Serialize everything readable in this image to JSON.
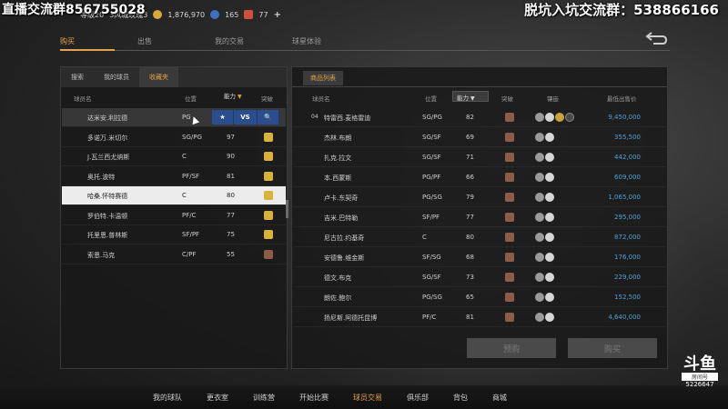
{
  "overlay": {
    "left_text": "直播交流群856755028",
    "right_text": "脱坑入坑交流群：538866166"
  },
  "topbar": {
    "player": "等级20",
    "team": "3风城玫瑰3",
    "coins": "1,876,970",
    "stars": "165",
    "diamonds": "77",
    "plus": "+"
  },
  "main_tabs": [
    {
      "label": "购买",
      "active": true
    },
    {
      "label": "出售",
      "active": false
    },
    {
      "label": "我的交易",
      "active": false
    },
    {
      "label": "球星体验",
      "active": false
    }
  ],
  "left_panel": {
    "subtabs": [
      {
        "label": "搜索",
        "active": false
      },
      {
        "label": "我的球员",
        "active": false
      },
      {
        "label": "收藏夹",
        "active": true
      }
    ],
    "headers": {
      "name": "球员名",
      "position": "位置",
      "ability": "能力",
      "badge": "突破"
    },
    "actions": {
      "star": "★",
      "vs": "VS",
      "search": "🔍"
    },
    "rows": [
      {
        "name": "达米安.利拉德",
        "position": "PG",
        "ability": "",
        "badge": "",
        "state": "hover"
      },
      {
        "name": "多诺万.米切尔",
        "position": "SG/PG",
        "ability": "97",
        "badge": "gold"
      },
      {
        "name": "J.瓦兰西尤纳斯",
        "position": "C",
        "ability": "90",
        "badge": "gold"
      },
      {
        "name": "奥托.波特",
        "position": "PF/SF",
        "ability": "81",
        "badge": "gold"
      },
      {
        "name": "哈桑.怀特赛德",
        "position": "C",
        "ability": "80",
        "badge": "gold",
        "state": "selected"
      },
      {
        "name": "罗伯特.卡温顿",
        "position": "PF/C",
        "ability": "77",
        "badge": "gold"
      },
      {
        "name": "托里恩.普林斯",
        "position": "SF/PF",
        "ability": "75",
        "badge": "gold"
      },
      {
        "name": "索恩.马克",
        "position": "C/PF",
        "ability": "55",
        "badge": "rust"
      }
    ]
  },
  "right_panel": {
    "tab": "商品列表",
    "headers": {
      "name": "球员名",
      "position": "位置",
      "ability": "能力",
      "badge": "突破",
      "slots": "镶嵌",
      "price": "最低出售价"
    },
    "rows": [
      {
        "name": "特雷西.麦格雷迪",
        "position": "SG/PG",
        "ability": "82",
        "price": "9,450,000",
        "prefix": "04"
      },
      {
        "name": "杰林.布朗",
        "position": "SG/SF",
        "ability": "69",
        "price": "355,500"
      },
      {
        "name": "扎克.拉文",
        "position": "SG/SF",
        "ability": "71",
        "price": "442,000"
      },
      {
        "name": "本.西蒙斯",
        "position": "PG/PF",
        "ability": "66",
        "price": "609,000"
      },
      {
        "name": "卢卡.东契奇",
        "position": "PG/SG",
        "ability": "79",
        "price": "1,065,000"
      },
      {
        "name": "吉米.巴特勒",
        "position": "SF/PF",
        "ability": "77",
        "price": "295,000"
      },
      {
        "name": "尼古拉.约基奇",
        "position": "C",
        "ability": "80",
        "price": "872,000"
      },
      {
        "name": "安德鲁.维金斯",
        "position": "SF/SG",
        "ability": "68",
        "price": "176,000"
      },
      {
        "name": "德文.布克",
        "position": "SG/SF",
        "ability": "73",
        "price": "229,000"
      },
      {
        "name": "朗佐.鲍尔",
        "position": "PG/SG",
        "ability": "65",
        "price": "152,500"
      },
      {
        "name": "扬尼斯.阿德托昆博",
        "position": "PF/C",
        "ability": "81",
        "price": "4,640,000"
      }
    ],
    "buttons": {
      "preorder": "预购",
      "buy": "购买"
    }
  },
  "bottom_nav": [
    {
      "label": "我的球队",
      "active": false
    },
    {
      "label": "更衣室",
      "active": false
    },
    {
      "label": "训练营",
      "active": false
    },
    {
      "label": "开始比赛",
      "active": false
    },
    {
      "label": "球员交易",
      "active": true
    },
    {
      "label": "俱乐部",
      "active": false
    },
    {
      "label": "背包",
      "active": false
    },
    {
      "label": "商城",
      "active": false
    }
  ],
  "watermark": {
    "logo": "斗鱼",
    "room_label": "房间号",
    "room_number": "5226647"
  },
  "colors": {
    "accent": "#e2a14a",
    "price": "#4fa3d8",
    "action_blue": "#2a4d8e"
  }
}
